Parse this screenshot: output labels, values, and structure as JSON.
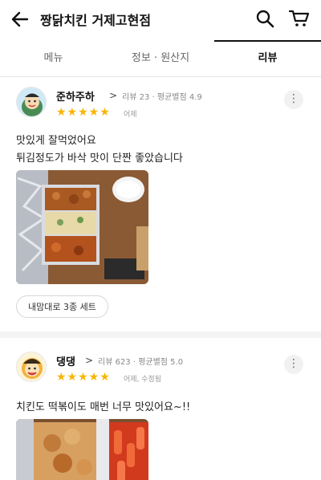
{
  "header": {
    "title": "짱닭치킨 거제고현점"
  },
  "tabs": [
    {
      "label": "메뉴",
      "active": false
    },
    {
      "label": "정보 · 원산지",
      "active": false
    },
    {
      "label": "리뷰",
      "active": true
    }
  ],
  "reviews": [
    {
      "nickname": "준하주하",
      "meta": "리뷰 23 · 평균별점 4.9",
      "rating": 5,
      "stars_text": "★★★★★",
      "menu": "어제",
      "lines": [
        "맛있게 잘먹었어요",
        "튀김정도가 바삭 맛이 단짠 좋았습니다"
      ],
      "menu_chip": "내맘대로 3종 세트"
    },
    {
      "nickname": "댕댕",
      "meta": "리뷰 623 · 평균별점 5.0",
      "rating": 5,
      "stars_text": "★★★★★",
      "menu": "어제, 수정됨",
      "lines": [
        "치킨도 떡볶이도 매번 너무 맛있어요~!!"
      ]
    }
  ],
  "more_glyph": "⋮",
  "chevron_glyph": ">",
  "colors": {
    "star": "#f8b500",
    "active_tab": "#111111"
  }
}
